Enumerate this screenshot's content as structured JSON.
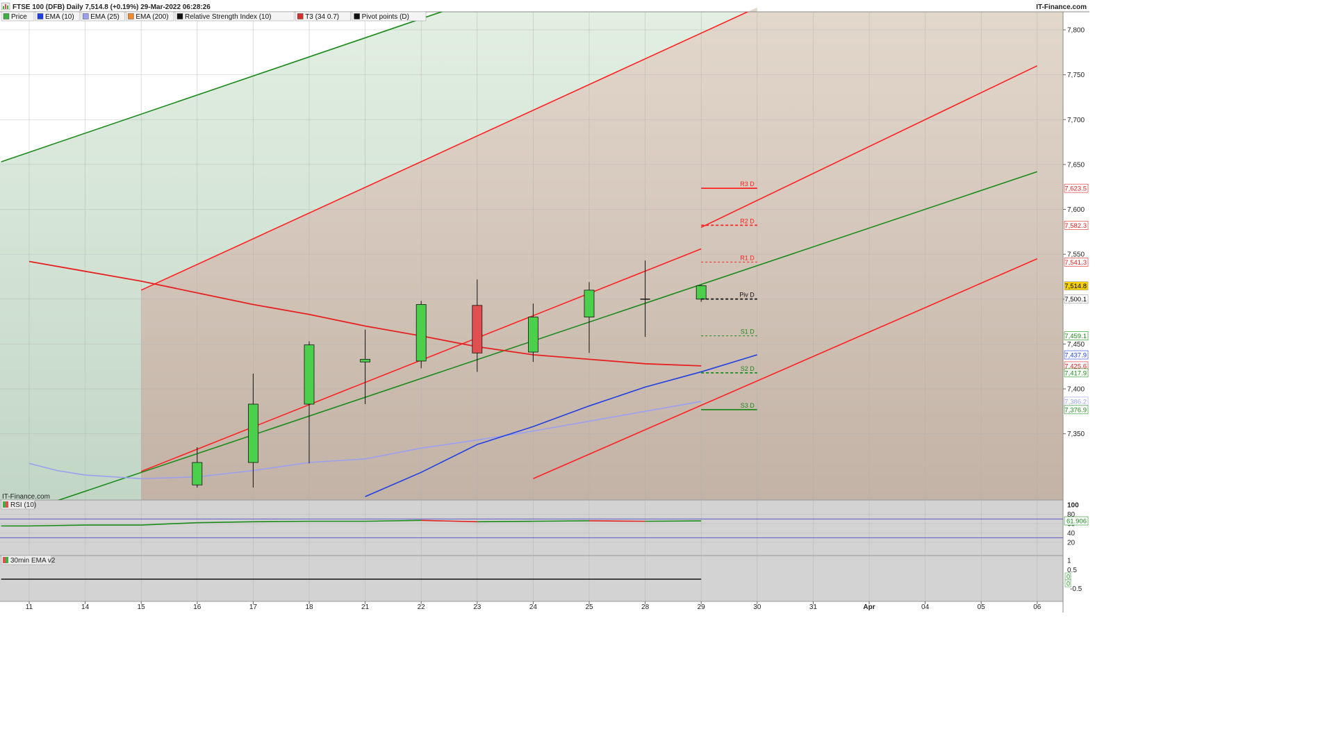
{
  "header": {
    "title": "FTSE 100 (DFB) Daily 7,514.8 (+0.19%) 29-Mar-2022 06:28:26",
    "brand": "IT-Finance.com",
    "watermark": "IT-Finance.com"
  },
  "legend": [
    {
      "label": "Price",
      "color": "#3cb043"
    },
    {
      "label": "EMA (10)",
      "color": "#1f3fe0"
    },
    {
      "label": "EMA (25)",
      "color": "#9aa0f0"
    },
    {
      "label": "EMA (200)",
      "color": "#f08a30"
    },
    {
      "label": "Relative Strength Index (10)",
      "color": "#111111"
    },
    {
      "label": "T3 (34 0.7)",
      "color": "#d03030"
    },
    {
      "label": "Pivot points (D)",
      "color": "#111111"
    }
  ],
  "colors": {
    "up": "#4cd04c",
    "down": "#e05050",
    "ema10": "#1f3fe0",
    "ema25": "#9aa0f0",
    "channel_red": "#ff2020",
    "channel_green": "#1a8a1a",
    "t3": "#e62020"
  },
  "chart_data": [
    {
      "type": "candlestick",
      "name": "price-panel",
      "x_dates": [
        "11",
        "14",
        "15",
        "16",
        "17",
        "18",
        "21",
        "22",
        "23",
        "24",
        "25",
        "28",
        "29",
        "30",
        "31",
        "Apr",
        "04",
        "05",
        "06"
      ],
      "ylim": [
        7300,
        7820
      ],
      "y_ticks": [
        "7,350",
        "7,400",
        "7,450",
        "7,500",
        "7,550",
        "7,600",
        "7,650",
        "7,700",
        "7,750",
        "7,800"
      ],
      "candles": [
        {
          "date": "16",
          "open": 7293,
          "high": 7335,
          "low": 7290,
          "close": 7318
        },
        {
          "date": "17",
          "open": 7318,
          "high": 7417,
          "low": 7290,
          "close": 7383
        },
        {
          "date": "18",
          "open": 7383,
          "high": 7453,
          "low": 7317,
          "close": 7449
        },
        {
          "date": "21",
          "open": 7430,
          "high": 7466,
          "low": 7383,
          "close": 7433
        },
        {
          "date": "22",
          "open": 7431,
          "high": 7498,
          "low": 7423,
          "close": 7494
        },
        {
          "date": "23",
          "open": 7493,
          "high": 7522,
          "low": 7419,
          "close": 7440
        },
        {
          "date": "24",
          "open": 7441,
          "high": 7495,
          "low": 7430,
          "close": 7480
        },
        {
          "date": "25",
          "open": 7480,
          "high": 7519,
          "low": 7440,
          "close": 7510
        },
        {
          "date": "28",
          "open": 7500,
          "high": 7543,
          "low": 7458,
          "close": 7500
        },
        {
          "date": "29",
          "open": 7500,
          "high": 7516,
          "low": 7497,
          "close": 7515
        }
      ],
      "ema10": [
        [
          6,
          7280
        ],
        [
          7,
          7307
        ],
        [
          8,
          7338
        ],
        [
          9,
          7358
        ],
        [
          10,
          7381
        ],
        [
          11,
          7402
        ],
        [
          12,
          7419
        ],
        [
          13,
          7438
        ]
      ],
      "ema25": [
        [
          0,
          7317
        ],
        [
          0.5,
          7309
        ],
        [
          1,
          7304
        ],
        [
          2,
          7300
        ],
        [
          3,
          7302
        ],
        [
          4,
          7309
        ],
        [
          5,
          7318
        ],
        [
          6,
          7322
        ],
        [
          7,
          7334
        ],
        [
          8,
          7343
        ],
        [
          9,
          7353
        ],
        [
          10,
          7364
        ],
        [
          11,
          7375
        ],
        [
          12,
          7386
        ]
      ],
      "t3": [
        [
          0,
          7542
        ],
        [
          1,
          7531
        ],
        [
          2,
          7520
        ],
        [
          3,
          7507
        ],
        [
          4,
          7494
        ],
        [
          5,
          7483
        ],
        [
          6,
          7470
        ],
        [
          7,
          7459
        ],
        [
          8,
          7447
        ],
        [
          9,
          7438
        ],
        [
          10,
          7433
        ],
        [
          11,
          7428
        ],
        [
          12,
          7425.6
        ]
      ],
      "channels": [
        {
          "color": "green",
          "pts": [
            [
              -0.5,
              7653
            ],
            [
              7.5,
              7823
            ]
          ]
        },
        {
          "color": "red",
          "pts": [
            [
              2,
              7510
            ],
            [
              13,
              7825
            ]
          ]
        },
        {
          "color": "red",
          "pts": [
            [
              12,
              7580
            ],
            [
              18,
              7760
            ]
          ]
        },
        {
          "color": "green",
          "pts": [
            [
              0,
              7265
            ],
            [
              18,
              7642
            ]
          ]
        },
        {
          "color": "red",
          "pts": [
            [
              9,
              7300
            ],
            [
              18,
              7545
            ]
          ]
        },
        {
          "color": "red",
          "pts": [
            [
              2,
              7308
            ],
            [
              12,
              7556
            ]
          ]
        }
      ],
      "pivots": [
        {
          "label": "R3 D",
          "value": 7623.5,
          "style": "solid",
          "color": "#ff2020"
        },
        {
          "label": "R2 D",
          "value": 7582.3,
          "style": "dashed",
          "color": "#ff2020"
        },
        {
          "label": "R1 D",
          "value": 7541.3,
          "style": "dashed-thin",
          "color": "#ff2020"
        },
        {
          "label": "Piv D",
          "value": 7500.1,
          "style": "dashed",
          "color": "#111111"
        },
        {
          "label": "S1 D",
          "value": 7459.1,
          "style": "dashed-thin",
          "color": "#1a8a1a"
        },
        {
          "label": "S2 D",
          "value": 7417.9,
          "style": "dashed",
          "color": "#1a8a1a"
        },
        {
          "label": "S3 D",
          "value": 7376.9,
          "style": "solid",
          "color": "#1a8a1a"
        }
      ],
      "right_labels": [
        {
          "text": "7,623.5",
          "value": 7623.5,
          "bg": "#ffffff",
          "fg": "#e02020"
        },
        {
          "text": "7,582.3",
          "value": 7582.3,
          "bg": "#ffffff",
          "fg": "#e02020"
        },
        {
          "text": "7,541.3",
          "value": 7541.3,
          "bg": "#ffffff",
          "fg": "#e02020"
        },
        {
          "text": "7,514.8",
          "value": 7514.8,
          "bg": "#f5d000",
          "fg": "#000000"
        },
        {
          "text": "7,500.1",
          "value": 7500.1,
          "bg": "#ffffff",
          "fg": "#000000"
        },
        {
          "text": "7,459.1",
          "value": 7459.1,
          "bg": "#ffffff",
          "fg": "#1a8a1a"
        },
        {
          "text": "7,437.9",
          "value": 7437.9,
          "bg": "#ffffff",
          "fg": "#1f3fe0"
        },
        {
          "text": "7,425.6",
          "value": 7425.6,
          "bg": "#ffffff",
          "fg": "#e02020"
        },
        {
          "text": "7,417.9",
          "value": 7417.9,
          "bg": "#ffffff",
          "fg": "#1a8a1a"
        },
        {
          "text": "7,386.2",
          "value": 7386.2,
          "bg": "#ffffff",
          "fg": "#9aa0f0"
        },
        {
          "text": "7,376.9",
          "value": 7376.9,
          "bg": "#ffffff",
          "fg": "#1a8a1a"
        }
      ]
    },
    {
      "type": "line",
      "name": "rsi-panel",
      "title": "RSI (10)",
      "ylim": [
        0,
        100
      ],
      "y_ticks": [
        "100",
        "80",
        "60",
        "40",
        "20"
      ],
      "levels": [
        70,
        30
      ],
      "current": "61.906",
      "values": [
        [
          -0.5,
          55
        ],
        [
          0,
          55
        ],
        [
          1,
          57
        ],
        [
          2,
          57
        ],
        [
          3,
          62
        ],
        [
          4,
          64
        ],
        [
          5,
          65
        ],
        [
          6,
          65
        ],
        [
          7,
          67
        ],
        [
          8,
          64
        ],
        [
          9,
          65
        ],
        [
          10,
          66
        ],
        [
          11,
          65
        ],
        [
          12,
          65.9
        ]
      ]
    },
    {
      "type": "line",
      "name": "ema30-panel",
      "title": "30min EMA v2",
      "ylim": [
        -0.5,
        1
      ],
      "y_ticks": [
        "1",
        "0.5",
        "0",
        "-0.5"
      ],
      "labels": [
        "0",
        "0"
      ],
      "values": [
        [
          -0.5,
          0
        ],
        [
          12,
          0
        ]
      ]
    }
  ]
}
